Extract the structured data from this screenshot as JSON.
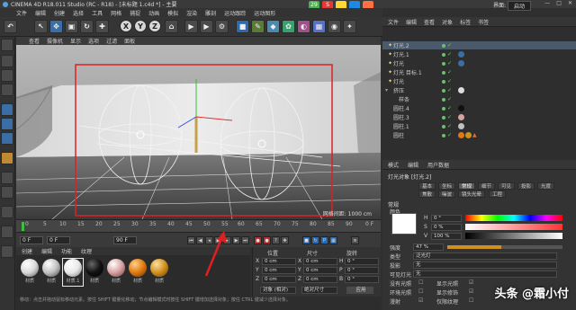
{
  "app": {
    "title": "CINEMA 4D R18.011 Studio (RC - R18) - [未标题 1.c4d *] - 主要",
    "layout_label": "界面:",
    "layout_value": "启动",
    "window_controls": [
      "—",
      "□",
      "✕"
    ]
  },
  "menu": {
    "items": [
      "文件",
      "编辑",
      "创建",
      "选择",
      "工具",
      "网格",
      "捕捉",
      "动画",
      "模拟",
      "渲染",
      "雕刻",
      "运动跟踪",
      "运动图形",
      "角色",
      "流水线",
      "插件",
      "脚本",
      "窗口",
      "帮助"
    ]
  },
  "ext_badges": {
    "a": "29",
    "b": "S"
  },
  "toolbar": {
    "x_label": "X",
    "y_label": "Y",
    "z_label": "Z",
    "undo_icon": "undo-icon"
  },
  "viewport": {
    "menu": [
      "查看",
      "摄像机",
      "显示",
      "选项",
      "过滤",
      "面板"
    ],
    "scale": "网格间距: 1000 cm"
  },
  "timeline": {
    "ticks": [
      "0",
      "5",
      "10",
      "15",
      "20",
      "25",
      "30",
      "35",
      "40",
      "45",
      "50",
      "55",
      "60",
      "65",
      "70",
      "75",
      "80",
      "85",
      "90"
    ],
    "end_label": "0 F"
  },
  "timebar": {
    "start": "0 F",
    "current": "0 F",
    "end": "90 F",
    "end2": "90 F"
  },
  "materials": {
    "menu": [
      "创建",
      "编辑",
      "功能",
      "纹理"
    ],
    "items": [
      {
        "label": "材质",
        "color": "#d8d8d8"
      },
      {
        "label": "材质",
        "color": "#c0c0c0"
      },
      {
        "label": "材质.1",
        "color": "#e8e8e8"
      },
      {
        "label": "材质",
        "color": "#111111"
      },
      {
        "label": "材质",
        "color": "#d8a0a0"
      },
      {
        "label": "材质",
        "color": "#e07a10"
      },
      {
        "label": "材质",
        "color": "#d09020"
      }
    ]
  },
  "status": {
    "line1": "移动：点击并拖动鼠标移动元素。按住 SHIFT 键量化移动；节点编辑模式时按住 SHIFT 键增加选择对象；按住 CTRL 键减少选择对象。"
  },
  "coords": {
    "headers": [
      "位置",
      "尺寸",
      "旋转"
    ],
    "rows": [
      {
        "axis": "X",
        "pos": "0 cm",
        "size": "0 cm",
        "rot_label": "H",
        "rot": "0 °"
      },
      {
        "axis": "Y",
        "pos": "0 cm",
        "size": "0 cm",
        "rot_label": "P",
        "rot": "0 °"
      },
      {
        "axis": "Z",
        "pos": "0 cm",
        "size": "0 cm",
        "rot_label": "B",
        "rot": "0 °"
      }
    ],
    "mode": "对象 (相对)",
    "size_mode": "绝对尺寸",
    "apply": "应用"
  },
  "objects": {
    "menu": [
      "文件",
      "编辑",
      "查看",
      "对象",
      "标签",
      "书签"
    ],
    "rows": [
      {
        "name": "灯光.2",
        "indent": 0,
        "selected": true
      },
      {
        "name": "灯光.1",
        "indent": 0,
        "selected": false
      },
      {
        "name": "灯光",
        "indent": 0,
        "selected": false
      },
      {
        "name": "灯光 目标.1",
        "indent": 0,
        "selected": false
      },
      {
        "name": "灯光",
        "indent": 0,
        "selected": false
      },
      {
        "name": "挤压",
        "indent": 0,
        "selected": false
      },
      {
        "name": "样条",
        "indent": 1,
        "selected": false
      },
      {
        "name": "圆柱.4",
        "indent": 0,
        "selected": false
      },
      {
        "name": "圆柱.3",
        "indent": 0,
        "selected": false
      },
      {
        "name": "圆柱.1",
        "indent": 0,
        "selected": false
      },
      {
        "name": "圆柱",
        "indent": 0,
        "selected": false
      }
    ]
  },
  "attributes": {
    "menu": [
      "模式",
      "编辑",
      "用户数据"
    ],
    "object_name": "灯光对象 [灯光.2]",
    "tabs": [
      "基本",
      "坐标",
      "常规",
      "细节",
      "可见",
      "投影",
      "光度",
      "焦散",
      "噪波",
      "镜头光晕",
      "工程"
    ],
    "section": "常规",
    "rows": [
      {
        "label": "颜色",
        "value": "",
        "type": "color"
      },
      {
        "label": "H",
        "value": "0 °",
        "type": "slider"
      },
      {
        "label": "S",
        "value": "0 %",
        "type": "slider"
      },
      {
        "label": "V",
        "value": "100 %",
        "type": "slider"
      },
      {
        "label": "强度",
        "value": "47 %",
        "type": "value"
      },
      {
        "label": "类型",
        "value": "泛光灯",
        "type": "value"
      },
      {
        "label": "投影",
        "value": "无",
        "type": "value"
      },
      {
        "label": "可见灯光",
        "value": "无",
        "type": "value"
      },
      {
        "label": "没有光照",
        "value": "",
        "type": "check"
      },
      {
        "label": "环境光照",
        "value": "",
        "type": "check"
      },
      {
        "label": "漫射",
        "value": "",
        "type": "check"
      },
      {
        "label": "显示光照",
        "value": "",
        "type": "check"
      },
      {
        "label": "显示修饰",
        "value": "",
        "type": "check"
      },
      {
        "label": "仅限纹理",
        "value": "",
        "type": "check"
      }
    ]
  },
  "watermark": "头条 @霜小付"
}
